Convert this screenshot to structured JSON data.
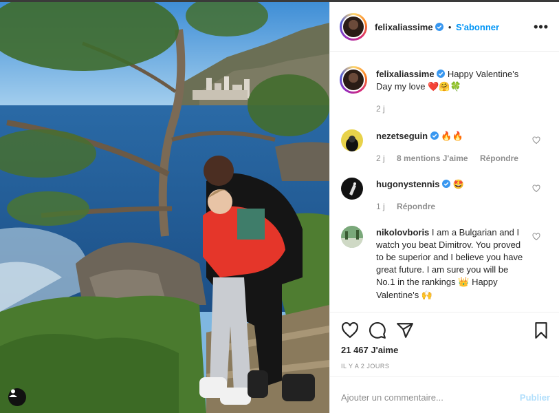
{
  "post": {
    "author": "felixaliassime",
    "follow_label": "S'abonner",
    "dot": "•",
    "more_label": "•••",
    "caption": "Happy Valentine's Day my love",
    "caption_emojis": "❤️🤗🍀",
    "caption_time": "2 j"
  },
  "comments": [
    {
      "user": "nezetseguin",
      "verified": true,
      "text": "",
      "emojis": "🔥🔥",
      "time": "2 j",
      "likes": "8 mentions J'aime",
      "reply": "Répondre",
      "avatar_color": "#e8d24a"
    },
    {
      "user": "hugonystennis",
      "verified": true,
      "text": "",
      "emojis": "🤩",
      "time": "1 j",
      "likes": "",
      "reply": "Répondre",
      "avatar_color": "#111111"
    },
    {
      "user": "nikolovboris",
      "verified": false,
      "text": "I am a Bulgarian and I watch you beat Dimitrov. You proved to be superior and I believe you have great future. I am sure you will be No.1 in the rankings",
      "emojis_mid": "👑",
      "text2": "Happy Valentine's",
      "emojis_end": "🙌",
      "avatar_color": "#7aa87a"
    }
  ],
  "stats": {
    "likes": "21 467 J'aime",
    "posted": "IL Y A 2 JOURS"
  },
  "add_comment": {
    "placeholder": "Ajouter un commentaire...",
    "publish": "Publier"
  },
  "colors": {
    "accent": "#0095f6",
    "publish_disabled": "#b2dffc",
    "muted": "#8e8e8e"
  },
  "icons": [
    "verified-icon",
    "more-icon",
    "heart-icon",
    "comment-icon",
    "share-icon",
    "bookmark-icon",
    "tag-user-icon"
  ]
}
